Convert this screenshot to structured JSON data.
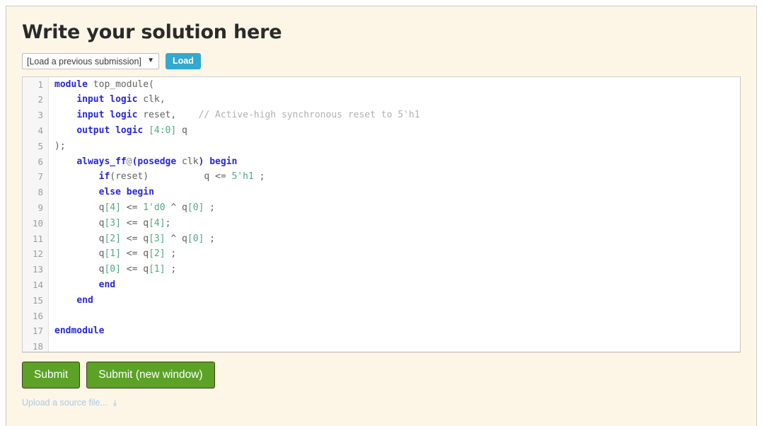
{
  "panel": {
    "title": "Write your solution here"
  },
  "load_row": {
    "select": {
      "selected": "[Load a previous submission]",
      "options": [
        "[Load a previous submission]"
      ],
      "chevron_icon": "chevron-down-icon"
    },
    "load_button_label": "Load"
  },
  "editor": {
    "line_count": 18,
    "lines": [
      {
        "n": "1",
        "tokens": [
          {
            "t": "module",
            "c": "kw"
          },
          {
            "t": " top_module(",
            "c": "id"
          }
        ]
      },
      {
        "n": "2",
        "tokens": [
          {
            "t": "    ",
            "c": "id"
          },
          {
            "t": "input logic",
            "c": "kw"
          },
          {
            "t": " clk,",
            "c": "id"
          }
        ]
      },
      {
        "n": "3",
        "tokens": [
          {
            "t": "    ",
            "c": "id"
          },
          {
            "t": "input logic",
            "c": "kw"
          },
          {
            "t": " reset,    ",
            "c": "id"
          },
          {
            "t": "// Active-high synchronous reset to 5'h1",
            "c": "com"
          }
        ]
      },
      {
        "n": "4",
        "tokens": [
          {
            "t": "    ",
            "c": "id"
          },
          {
            "t": "output logic",
            "c": "kw"
          },
          {
            "t": " ",
            "c": "id"
          },
          {
            "t": "[4:0]",
            "c": "brk"
          },
          {
            "t": " q",
            "c": "id"
          }
        ]
      },
      {
        "n": "5",
        "tokens": [
          {
            "t": ");",
            "c": "id"
          }
        ]
      },
      {
        "n": "6",
        "tokens": [
          {
            "t": "    ",
            "c": "id"
          },
          {
            "t": "always_ff",
            "c": "kw"
          },
          {
            "t": "@",
            "c": "at"
          },
          {
            "t": "(",
            "c": "kw"
          },
          {
            "t": "posedge",
            "c": "kw"
          },
          {
            "t": " clk",
            "c": "id"
          },
          {
            "t": ")",
            "c": "kw"
          },
          {
            "t": " ",
            "c": "id"
          },
          {
            "t": "begin",
            "c": "kw"
          }
        ]
      },
      {
        "n": "7",
        "tokens": [
          {
            "t": "        ",
            "c": "id"
          },
          {
            "t": "if",
            "c": "kw"
          },
          {
            "t": "(reset)          q <= ",
            "c": "id"
          },
          {
            "t": "5'h1",
            "c": "num"
          },
          {
            "t": " ;",
            "c": "id"
          }
        ]
      },
      {
        "n": "8",
        "tokens": [
          {
            "t": "        ",
            "c": "id"
          },
          {
            "t": "else begin",
            "c": "kw"
          }
        ]
      },
      {
        "n": "9",
        "tokens": [
          {
            "t": "        q",
            "c": "id"
          },
          {
            "t": "[4]",
            "c": "brk"
          },
          {
            "t": " <= ",
            "c": "id"
          },
          {
            "t": "1'd0",
            "c": "num"
          },
          {
            "t": " ^ q",
            "c": "id"
          },
          {
            "t": "[0]",
            "c": "brk"
          },
          {
            "t": " ;",
            "c": "id"
          }
        ]
      },
      {
        "n": "10",
        "tokens": [
          {
            "t": "        q",
            "c": "id"
          },
          {
            "t": "[3]",
            "c": "brk"
          },
          {
            "t": " <= q",
            "c": "id"
          },
          {
            "t": "[4]",
            "c": "brk"
          },
          {
            "t": ";",
            "c": "id"
          }
        ]
      },
      {
        "n": "11",
        "tokens": [
          {
            "t": "        q",
            "c": "id"
          },
          {
            "t": "[2]",
            "c": "brk"
          },
          {
            "t": " <= q",
            "c": "id"
          },
          {
            "t": "[3]",
            "c": "brk"
          },
          {
            "t": " ^ q",
            "c": "id"
          },
          {
            "t": "[0]",
            "c": "brk"
          },
          {
            "t": " ;",
            "c": "id"
          }
        ]
      },
      {
        "n": "12",
        "tokens": [
          {
            "t": "        q",
            "c": "id"
          },
          {
            "t": "[1]",
            "c": "brk"
          },
          {
            "t": " <= q",
            "c": "id"
          },
          {
            "t": "[2]",
            "c": "brk"
          },
          {
            "t": " ;",
            "c": "id"
          }
        ]
      },
      {
        "n": "13",
        "tokens": [
          {
            "t": "        q",
            "c": "id"
          },
          {
            "t": "[0]",
            "c": "brk"
          },
          {
            "t": " <= q",
            "c": "id"
          },
          {
            "t": "[1]",
            "c": "brk"
          },
          {
            "t": " ;",
            "c": "id"
          }
        ]
      },
      {
        "n": "14",
        "tokens": [
          {
            "t": "        ",
            "c": "id"
          },
          {
            "t": "end",
            "c": "kw"
          }
        ]
      },
      {
        "n": "15",
        "tokens": [
          {
            "t": "    ",
            "c": "id"
          },
          {
            "t": "end",
            "c": "kw"
          }
        ]
      },
      {
        "n": "16",
        "tokens": []
      },
      {
        "n": "17",
        "tokens": [
          {
            "t": "endmodule",
            "c": "kw"
          }
        ]
      },
      {
        "n": "18",
        "tokens": []
      }
    ]
  },
  "actions": {
    "submit_label": "Submit",
    "submit_new_window_label": "Submit (new window)"
  },
  "upload": {
    "link_label": "Upload a source file...",
    "expand_icon": "double-chevron-down-icon"
  },
  "colors": {
    "panel_background": "#fdf6e7",
    "load_button": "#35a8cd",
    "submit_button": "#5ba226",
    "keyword": "#2727d8",
    "number": "#4faa7e",
    "comment": "#b1b1b1",
    "line_number": "#9d9d9d",
    "title": "#2a2a2a",
    "upload_link": "#a9cbe4"
  }
}
